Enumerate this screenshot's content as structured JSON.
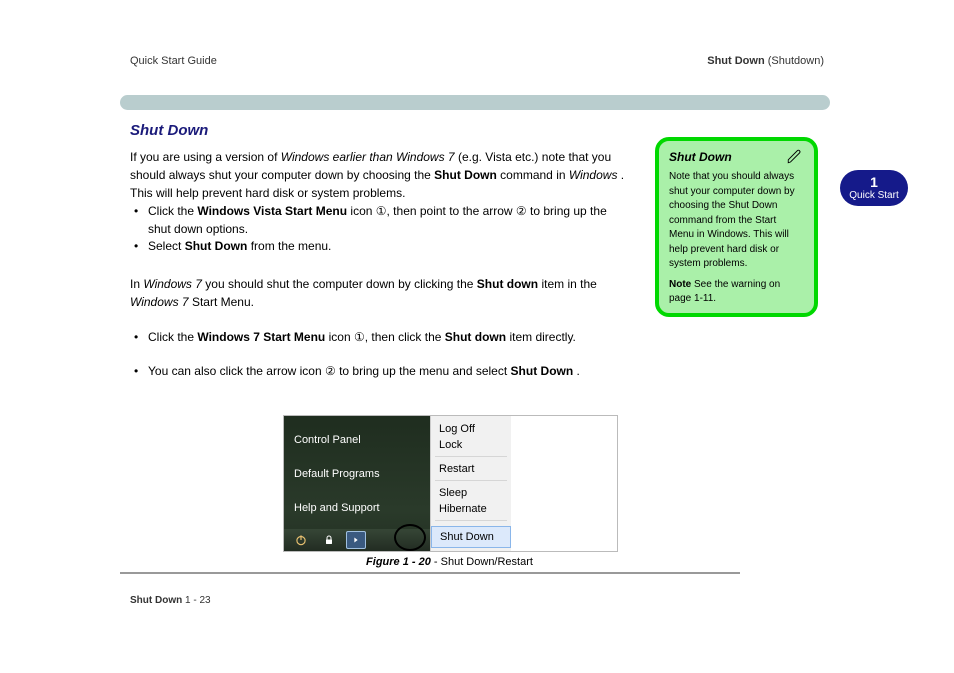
{
  "header": {
    "trail": "Quick Start Guide",
    "right_bold": "Shut Down",
    "right_small": "(Shutdown)"
  },
  "section": {
    "title": "Shut Down"
  },
  "prewin": {
    "intro_label": "If you are using a version of ",
    "intro_os": "Windows earlier than Windows 7",
    "intro_rest": " (e.g. Vista etc.) note that you should always shut your computer down by choosing the ",
    "intro_cmd": "Shut Down",
    "intro_after": " command in ",
    "intro_win": "Windows",
    "intro_end": ". This will help prevent hard disk or system problems.",
    "b1_a": "Click the ",
    "b1_b": "Windows Vista Start Menu",
    "b1_c": " icon ①, then point to the arrow ② to bring up the shut down options.",
    "b2_a": "Select ",
    "b2_b": "Shut Down",
    "b2_c": " from the menu."
  },
  "win7": {
    "intro_a": "In ",
    "intro_b": "Windows 7",
    "intro_c": " you should shut the computer down by clicking the ",
    "intro_d": "Shut down",
    "intro_e": " item in the ",
    "intro_f": "Windows 7",
    "intro_g": " Start Menu.",
    "b3_a": "Click the ",
    "b3_b": "Windows 7 Start Menu",
    "b3_c": " icon ①, then click the ",
    "b3_d": "Shut down",
    "b3_e": " item directly.",
    "b4_a": "You can also click the arrow icon ② to bring up the menu and select ",
    "b4_b": "Shut Down",
    "b4_c": "."
  },
  "annotation": {
    "title": "Shut Down",
    "body": "Note that you should always shut your computer down by choosing the Shut Down command from the Start Menu in Windows. This will help prevent hard disk or system problems.",
    "note_label": "Note",
    "note_body": " See the warning on page 1-11."
  },
  "page_tab": {
    "ch": "1",
    "label": "Quick Start"
  },
  "shot": {
    "left": {
      "cp": "Control Panel",
      "dp": "Default Programs",
      "hs": "Help and Support"
    },
    "right": {
      "lo": "Log Off",
      "lk": "Lock",
      "rs": "Restart",
      "sl": "Sleep",
      "hb": "Hibernate",
      "sd": "Shut Down"
    }
  },
  "figure": {
    "label": "Figure 1 - 20",
    "dash": " - ",
    "name": "Shut Down/Restart"
  },
  "footer": {
    "left_bold": "Shut Down",
    "left_page": " 1 - 23",
    "right": ""
  }
}
